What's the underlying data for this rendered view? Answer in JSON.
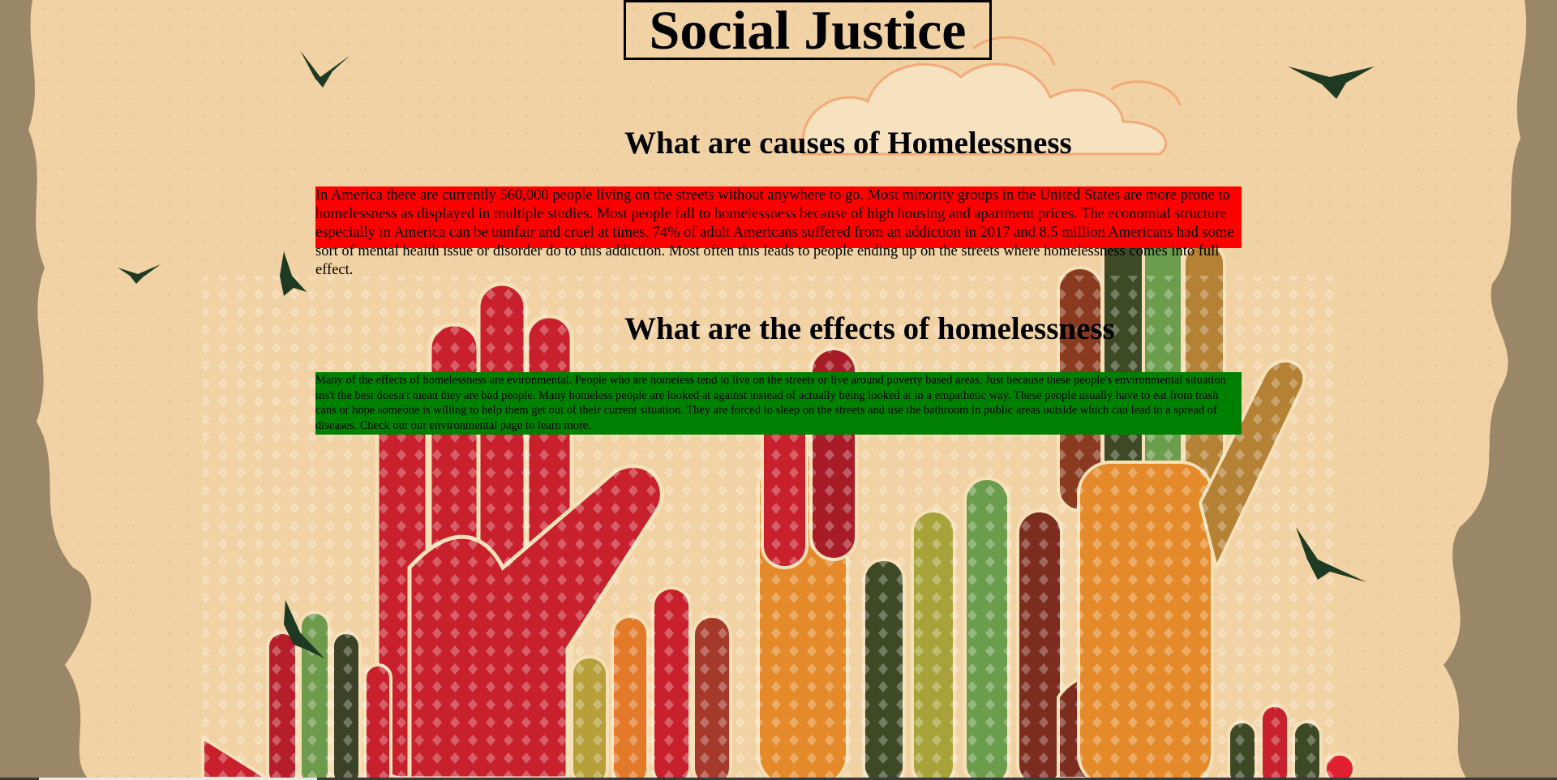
{
  "page": {
    "title": "Social Justice"
  },
  "causes": {
    "heading": "What are causes of Homelessness",
    "text": "In America there are currently 560,000 people living on the streets without anywhere to go. Most minority groups in the United States are more prone to homelessness as displayed in multiple studies. Most people fall to homelessness because of high housing and apartment prices. The economial structure especially in America can be uunfair and cruel at times. 74% of adult Americans suffered from an addiction in 2017 and 8.5 million Americans had some sort of mental health issue or disorder do to this addiction. Most often this leads to people ending up on the streets where homelessness comes into full effect."
  },
  "effects": {
    "heading": "What are the effects of homelessness",
    "text": "Many of the effects of homelessness are evironmental. People who are homeless tend to live on the streets or live around poverty based areas. Just because these people's environmental situation ins't the best doesn't mean they are bad people. Many homeless people are looked at against instead of actually being looked at in a empathetic way. These people usually have to eat from trash cans or hope someone is willing to help them get out of their current situation. They are forced to sleep on the streets and use the bathroom in public areas outside which can lead to a spread of diseases. Check out our environmental page to learn more."
  },
  "colors": {
    "background": "#f1d2a4",
    "causes_highlight": "#ff0000",
    "effects_highlight": "#008000"
  },
  "background_art": {
    "icons": [
      "raised-hands-illustration",
      "bird-icon",
      "cloud-icon",
      "grunge-border"
    ]
  }
}
